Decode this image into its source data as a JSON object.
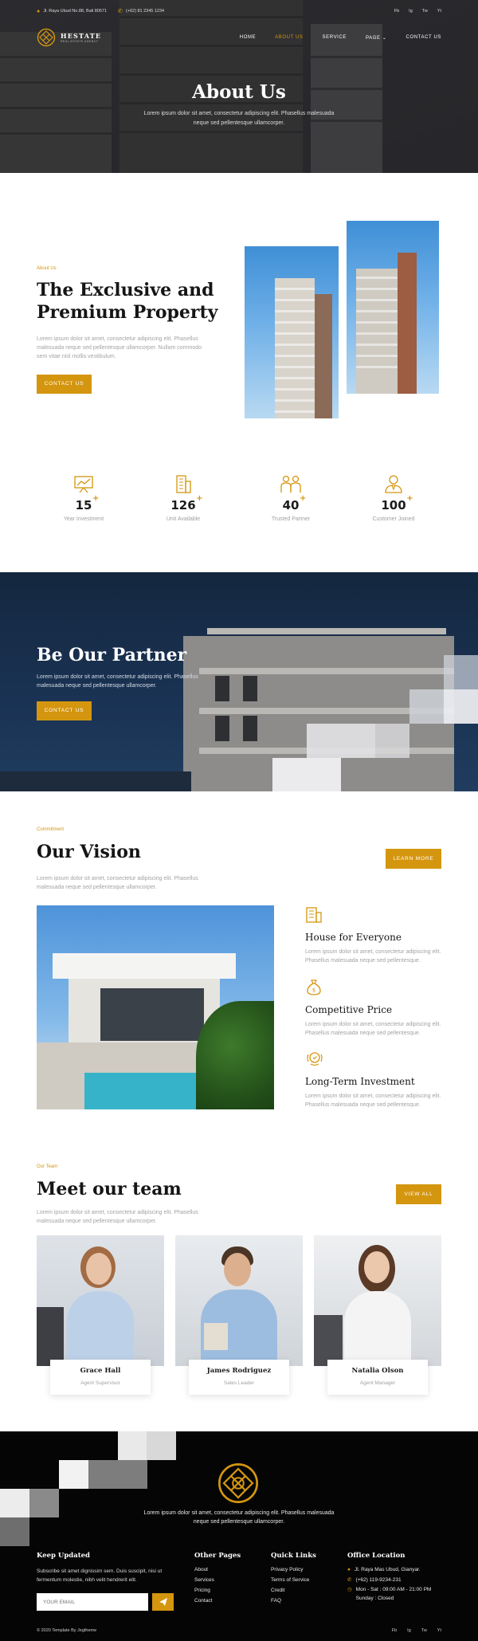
{
  "topbar": {
    "address": "Jl. Raya Ubud No.88, Bali 80571",
    "phone": "(+62) 81 2345 1234",
    "socials": [
      "Fb",
      "Ig",
      "Tw",
      "Yt"
    ]
  },
  "brand": {
    "name": "HESTATE",
    "tagline": "REAL ESTATE AGENCY"
  },
  "nav": [
    {
      "label": "HOME",
      "active": false
    },
    {
      "label": "ABOUT US",
      "active": true
    },
    {
      "label": "SERVICE",
      "active": false
    },
    {
      "label": "PAGE",
      "active": false,
      "has_dropdown": true
    },
    {
      "label": "CONTACT US",
      "active": false
    }
  ],
  "hero": {
    "title": "About Us",
    "subtitle": "Lorem ipsum dolor sit amet, consectetur adipiscing elit. Phasellus malesuada neque sed pellentesque ullamcorper."
  },
  "about": {
    "eyebrow": "About Us",
    "title": "The Exclusive and Premium Property",
    "text": "Lorem ipsum dolor sit amet, consectetur adipiscing elit. Phasellus malesuada neque sed pellentesque ullamcorper. Nullam commodo sem vitae nisl mollis vestibulum.",
    "button": "CONTACT US"
  },
  "stats": [
    {
      "number": "15",
      "label": "Year Investment",
      "icon": "presentation-chart-icon"
    },
    {
      "number": "126",
      "label": "Unit Available",
      "icon": "buildings-icon"
    },
    {
      "number": "40",
      "label": "Trusted Partner",
      "icon": "partners-icon"
    },
    {
      "number": "100",
      "label": "Customer Joined",
      "icon": "customer-icon"
    }
  ],
  "stat_plus": "+",
  "partner": {
    "title": "Be Our Partner",
    "text": "Lorem ipsum dolor sit amet, consectetur adipiscing elit. Phasellus malesuada neque sed pellentesque ullamcorper.",
    "button": "CONTACT US"
  },
  "vision": {
    "eyebrow": "Commitment",
    "title": "Our Vision",
    "text": "Lorem ipsum dolor sit amet, consectetur adipiscing elit. Phasellus malesuada neque sed pellentesque ullamcorper.",
    "button": "LEARN MORE",
    "features": [
      {
        "icon": "house-icon",
        "title": "House for Everyone",
        "text": "Lorem ipsum dolor sit amet, consectetur adipiscing elit. Phasellus malesuada neque sed pellentesque."
      },
      {
        "icon": "money-bag-icon",
        "title": "Competitive Price",
        "text": "Lorem ipsum dolor sit amet, consectetur adipiscing elit. Phasellus malesuada neque sed pellentesque."
      },
      {
        "icon": "award-icon",
        "title": "Long-Term Investment",
        "text": "Lorem ipsum dolor sit amet, consectetur adipiscing elit. Phasellus malesuada neque sed pellentesque."
      }
    ]
  },
  "team": {
    "eyebrow": "Our Team",
    "title": "Meet our team",
    "text": "Lorem ipsum dolor sit amet, consectetur adipiscing elit. Phasellus malesuada neque sed pellentesque ullamcorper.",
    "button": "VIEW ALL",
    "members": [
      {
        "name": "Grace Hall",
        "role": "Agent Supervisor"
      },
      {
        "name": "James Rodriguez",
        "role": "Sales Leader"
      },
      {
        "name": "Natalia Olson",
        "role": "Agent Manager"
      }
    ]
  },
  "footer": {
    "tagline": "Lorem ipsum dolor sit amet, consectetur adipiscing elit. Phasellus malesuada neque sed pellentesque ullamcorper.",
    "keep_updated": {
      "title": "Keep Updated",
      "text": "Subscribe sit amet dignissim sem. Duis suscipit, nisi ut fermentum molestie, nibh velit hendrerit elit.",
      "email_placeholder": "YOUR EMAIL"
    },
    "other_pages": {
      "title": "Other Pages",
      "links": [
        "About",
        "Services",
        "Pricing",
        "Contact"
      ]
    },
    "quick_links": {
      "title": "Quick Links",
      "links": [
        "Privacy Policy",
        "Terms of Service",
        "Credit",
        "FAQ"
      ]
    },
    "office": {
      "title": "Office Location",
      "address": "Jl. Raya Mas Ubud, Gianyar.",
      "phone": "(+62) 119-9234-231",
      "hours": "Mon - Sat : 09:00 AM - 21:00 PM Sunday : Closed"
    },
    "copyright": "© 2020 Template By Jegtheme",
    "socials": [
      "Fb",
      "Ig",
      "Tw",
      "Yt"
    ]
  },
  "colors": {
    "accent": "#d4960f",
    "dark": "#050505",
    "navy": "#1a3354"
  }
}
